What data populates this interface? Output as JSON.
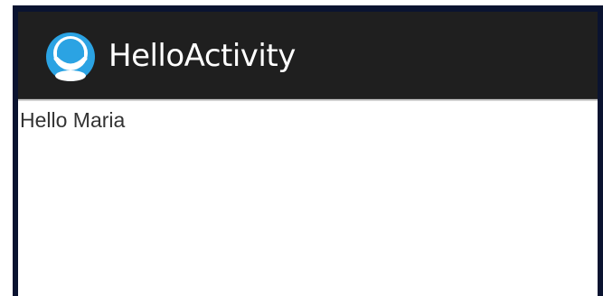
{
  "action_bar": {
    "app_icon": "smiley-app-icon",
    "title": "HelloActivity"
  },
  "content": {
    "greeting": "Hello Maria"
  },
  "colors": {
    "action_bar_bg": "#1f1f1f",
    "title_text": "#ffffff",
    "content_bg": "#ffffff",
    "icon_blue": "#2ba3e3"
  }
}
